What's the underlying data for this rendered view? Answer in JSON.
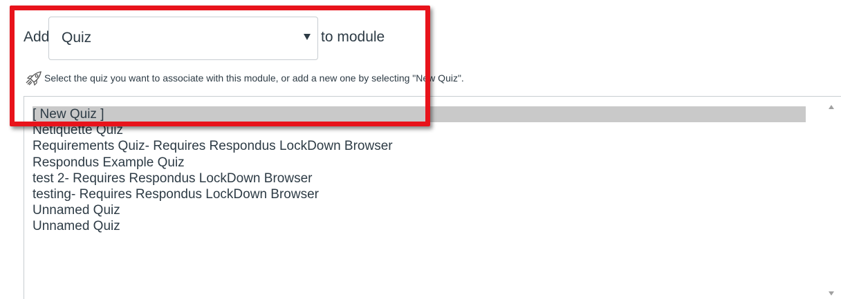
{
  "add_row": {
    "add_label": "Add",
    "selected_type": "Quiz",
    "to_module_label": "to module"
  },
  "hint": {
    "icon": "rocket-icon",
    "text": "Select the quiz you want to associate with this module, or add a new one by selecting \"New Quiz\"."
  },
  "quiz_list": {
    "items": [
      {
        "label": "[ New Quiz ]",
        "selected": true
      },
      {
        "label": "Netiquette Quiz",
        "selected": false
      },
      {
        "label": "Requirements Quiz- Requires Respondus LockDown Browser",
        "selected": false
      },
      {
        "label": "Respondus Example Quiz",
        "selected": false
      },
      {
        "label": "test 2- Requires Respondus LockDown Browser",
        "selected": false
      },
      {
        "label": "testing- Requires Respondus LockDown Browser",
        "selected": false
      },
      {
        "label": "Unnamed Quiz",
        "selected": false
      },
      {
        "label": "Unnamed Quiz",
        "selected": false
      }
    ]
  },
  "colors": {
    "highlight": "#e8131b",
    "selected_item": "#c9c9c9",
    "text": "#2d3b45"
  }
}
